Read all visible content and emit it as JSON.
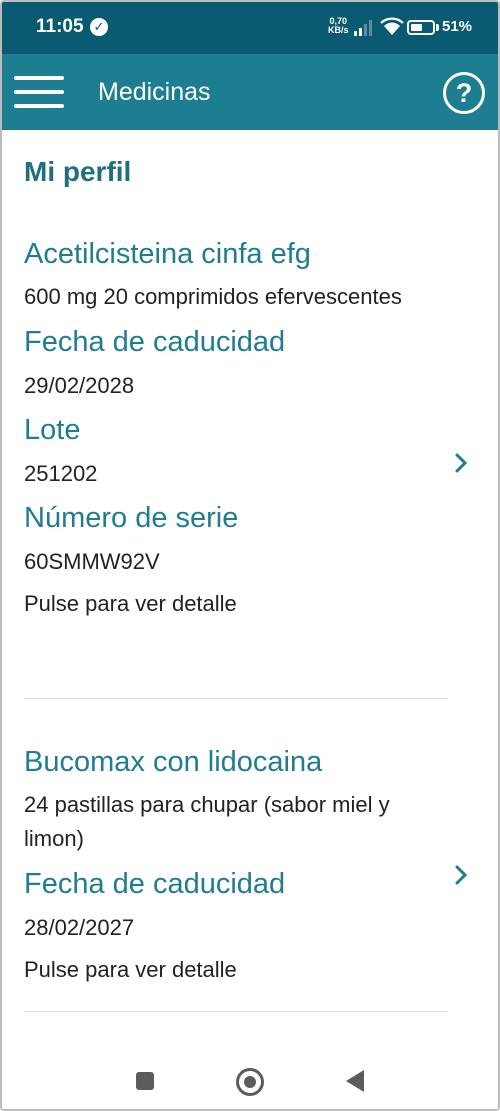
{
  "status_bar": {
    "time": "11:05",
    "speed_value": "0,70",
    "speed_unit": "KB/s",
    "battery_percent": "51%"
  },
  "app_bar": {
    "title": "Medicinas",
    "help_label": "?"
  },
  "main": {
    "heading": "Mi perfil",
    "medicines": [
      {
        "name": "Acetilcisteina cinfa efg",
        "description": "600 mg 20 comprimidos efervescentes",
        "expiry_label": "Fecha de caducidad",
        "expiry_value": "29/02/2028",
        "lot_label": "Lote",
        "lot_value": "251202",
        "serial_label": "Número de serie",
        "serial_value": "60SMMW92V",
        "hint": "Pulse para ver detalle"
      },
      {
        "name": "Bucomax con lidocaina",
        "description": "24 pastillas para chupar (sabor miel y limon)",
        "expiry_label": "Fecha de caducidad",
        "expiry_value": "28/02/2027",
        "hint": "Pulse para ver detalle"
      }
    ]
  },
  "colors": {
    "status_bar": "#0a5a72",
    "app_bar": "#1d7d91",
    "accent_text": "#1f7d91"
  },
  "icons": {
    "status_check": "check-circle-icon",
    "menu": "hamburger-menu-icon",
    "help": "help-circle-icon",
    "chevron": "chevron-right-icon",
    "nav_recent": "square-icon",
    "nav_home": "circle-home-icon",
    "nav_back": "triangle-back-icon"
  }
}
